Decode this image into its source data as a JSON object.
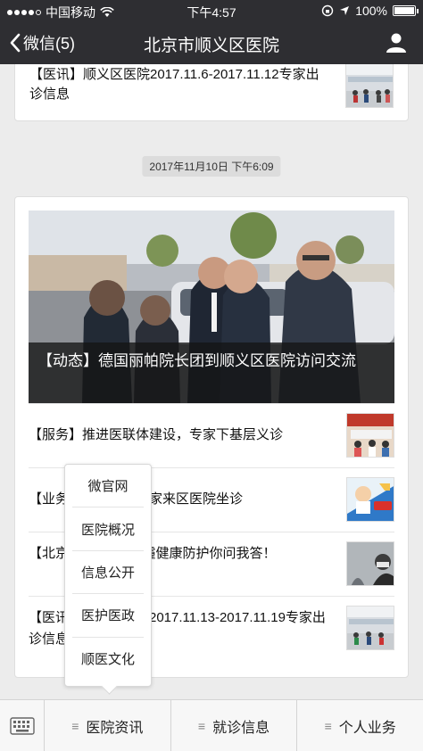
{
  "status_bar": {
    "carrier": "中国移动",
    "time": "下午4:57",
    "battery_text": "100%",
    "battery_level": 1.0
  },
  "nav": {
    "back_label": "微信(5)",
    "title": "北京市顺义区医院",
    "back_icon": "chevron-left-icon",
    "profile_icon": "person-icon"
  },
  "articles_top": {
    "title": "【医讯】顺义区医院2017.11.6-2017.11.12专家出诊信息"
  },
  "timestamp": "2017年11月10日 下午6:09",
  "feature": {
    "caption": "【动态】德国丽帕院长团到顺义区医院访问交流"
  },
  "articles": [
    {
      "title": "【服务】推进医联体建设，专家下基层义诊"
    },
    {
      "title": "【业务】北京xx科专家来区医院坐诊"
    },
    {
      "title": "【北京】【健康】雾霾健康防护你问我答！"
    },
    {
      "title": "【医讯】顺义区医院2017.11.13-2017.11.19专家出诊信息"
    }
  ],
  "popup_menu": {
    "items": [
      "微官网",
      "医院概况",
      "信息公开",
      "医护医政",
      "顺医文化"
    ]
  },
  "bottom_menu": {
    "tabs": [
      "医院资讯",
      "就诊信息",
      "个人业务"
    ],
    "keyboard_icon": "keyboard-icon"
  },
  "colors": {
    "header_bg": "#2e2e32",
    "page_bg": "#ececec"
  }
}
